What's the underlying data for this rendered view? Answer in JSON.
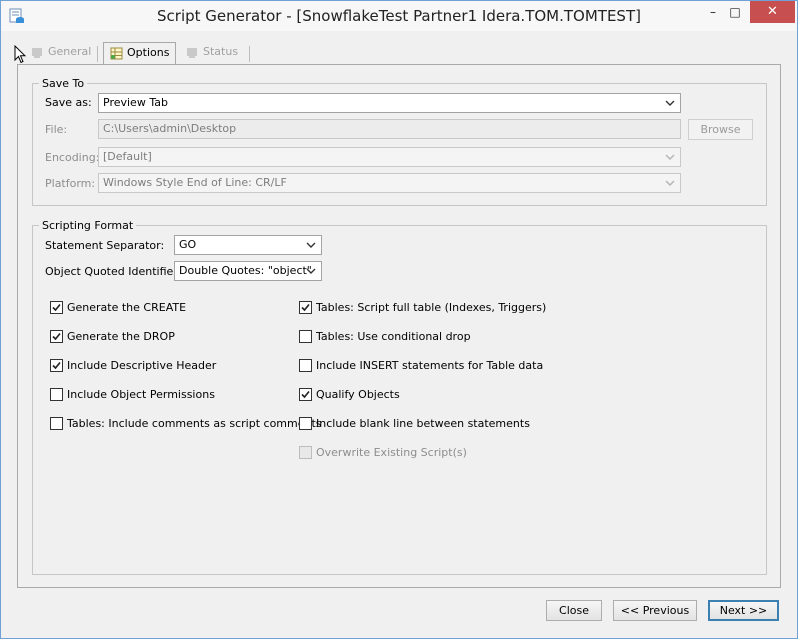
{
  "window": {
    "title": "Script Generator - [SnowflakeTest Partner1 Idera.TOM.TOMTEST]",
    "controls": {
      "minimize": "–",
      "maximize": "□",
      "close": "✕"
    }
  },
  "tabs": [
    {
      "label": "General",
      "state": "disabled"
    },
    {
      "label": "Options",
      "state": "active"
    },
    {
      "label": "Status",
      "state": "disabled"
    }
  ],
  "save_to": {
    "legend": "Save To",
    "save_as": {
      "label": "Save as:",
      "value": "Preview Tab"
    },
    "file": {
      "label": "File:",
      "value": "C:\\Users\\admin\\Desktop",
      "browse_label": "Browse"
    },
    "encoding": {
      "label": "Encoding:",
      "value": "[Default]"
    },
    "platform": {
      "label": "Platform:",
      "value": "Windows Style End of Line: CR/LF"
    }
  },
  "scripting_format": {
    "legend": "Scripting Format",
    "statement_separator": {
      "label": "Statement Separator:",
      "value": "GO"
    },
    "quoted_identifier": {
      "label": "Object Quoted Identifier:",
      "value": "Double Quotes: \"object\""
    },
    "left_options": [
      {
        "label": "Generate the CREATE",
        "checked": true
      },
      {
        "label": "Generate the DROP",
        "checked": true
      },
      {
        "label": "Include Descriptive Header",
        "checked": true
      },
      {
        "label": "Include Object Permissions",
        "checked": false
      },
      {
        "label": "Tables: Include comments as script comments",
        "checked": false
      }
    ],
    "right_options": [
      {
        "label": "Tables: Script full table (Indexes, Triggers)",
        "checked": true
      },
      {
        "label": "Tables: Use conditional drop",
        "checked": false
      },
      {
        "label": "Include INSERT statements for Table data",
        "checked": false
      },
      {
        "label": "Qualify Objects",
        "checked": true
      },
      {
        "label": "Include blank line between statements",
        "checked": false
      },
      {
        "label": "Overwrite Existing Script(s)",
        "checked": false,
        "disabled": true
      }
    ]
  },
  "footer": {
    "close_label": "Close",
    "previous_label": "<< Previous",
    "next_label": "Next >>"
  },
  "colors": {
    "title_bar_close": "#c74f4f",
    "window_border": "#6fa0d6",
    "focus_border": "#3c7fb1"
  }
}
